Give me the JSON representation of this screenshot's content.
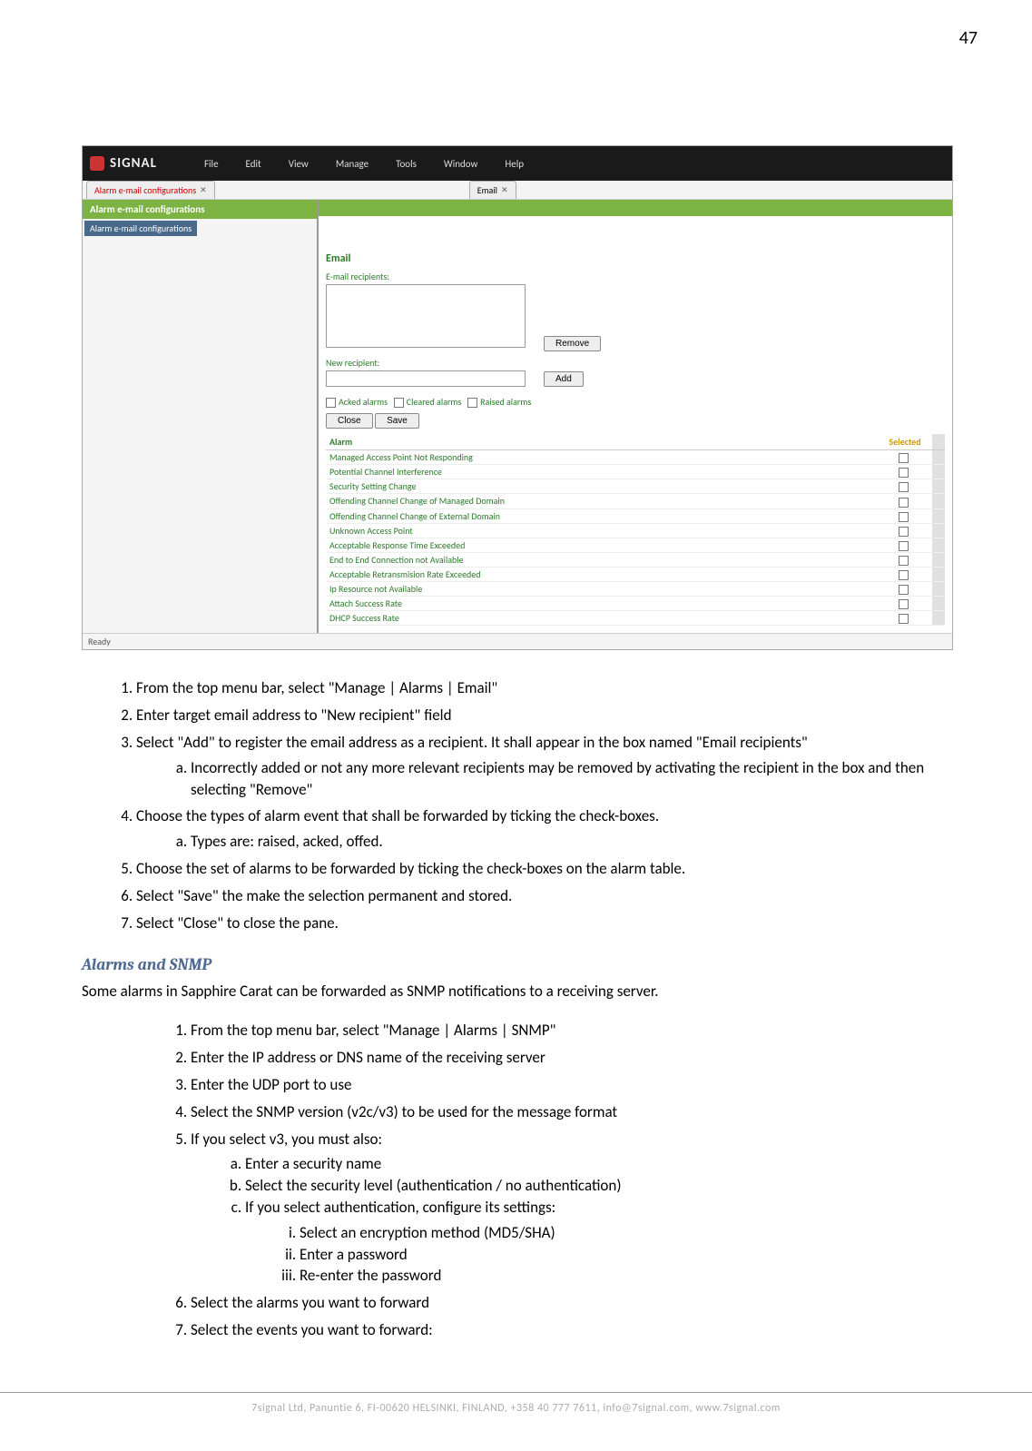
{
  "page_number": "47",
  "screenshot": {
    "app_name": "SIGNAL",
    "menu": [
      "File",
      "Edit",
      "View",
      "Manage",
      "Tools",
      "Window",
      "Help"
    ],
    "tab_left_label": "Alarm e-mail configurations",
    "tab_right_label": "Email",
    "side_header": "Alarm e-mail configurations",
    "tree_item": "Alarm e-mail configurations",
    "section_title": "Email",
    "recipients_label": "E-mail recipients:",
    "new_recipient_label": "New recipient:",
    "remove_btn": "Remove",
    "add_btn": "Add",
    "chk1": "Acked alarms",
    "chk2": "Cleared alarms",
    "chk3": "Raised alarms",
    "close_btn": "Close",
    "save_btn": "Save",
    "col_alarm": "Alarm",
    "col_selected": "Selected",
    "alarms": [
      "Managed Access Point Not Responding",
      "Potential Channel Interference",
      "Security Setting Change",
      "Offending Channel Change of Managed Domain",
      "Offending Channel Change of External Domain",
      "Unknown Access Point",
      "Acceptable Response Time Exceeded",
      "End to End Connection not Available",
      "Acceptable Retransmision Rate Exceeded",
      "Ip Resource not Available",
      "Attach Success Rate",
      "DHCP Success Rate"
    ],
    "ready": "Ready"
  },
  "instructions_email": [
    "From the top menu bar, select \"Manage | Alarms | Email\"",
    "Enter target email address to \"New recipient\" field",
    "Select \"Add\" to register the email address as a recipient. It shall appear in the box named \"Email recipients\"",
    "Choose the types of alarm event that shall be forwarded by ticking the check-boxes.",
    "Choose the set of alarms to be forwarded by ticking the check-boxes on the alarm table.",
    "Select \"Save\" the make the selection permanent and stored.",
    "Select \"Close\" to close the pane."
  ],
  "email_sub_3a": "Incorrectly added or not any more relevant recipients may be removed by activating the recipient in the box and then selecting \"Remove\"",
  "email_sub_4a": "Types are: raised, acked, offed.",
  "snmp_heading": "Alarms and SNMP",
  "snmp_intro": "Some alarms in Sapphire Carat can be forwarded as SNMP notifications to a receiving server.",
  "instructions_snmp": [
    "From the top menu bar, select \"Manage | Alarms | SNMP\"",
    "Enter the IP address or DNS name of the receiving server",
    "Enter the UDP port to use",
    "Select the SNMP version (v2c/v3) to be used for the message format",
    "If you select v3, you must also:",
    "Select the alarms you want to forward",
    "Select the events you want to forward:"
  ],
  "snmp_sub5": [
    "Enter a security name",
    "Select the security level (authentication / no authentication)",
    "If you select authentication, configure its settings:"
  ],
  "snmp_sub5c": [
    "Select an encryption method (MD5/SHA)",
    "Enter a password",
    "Re-enter the password"
  ],
  "footer": "7signal Ltd, Panuntie 6, FI-00620 HELSINKI, FINLAND, +358 40 777 7611, info@7signal.com, www.7signal.com"
}
